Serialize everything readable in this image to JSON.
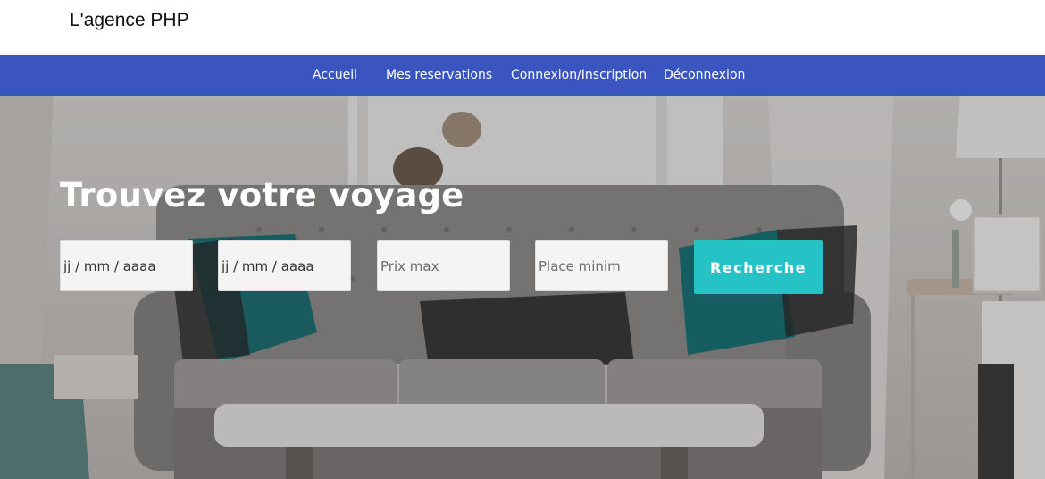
{
  "brand": {
    "title": "L'agence PHP"
  },
  "nav": {
    "items": [
      {
        "label": "Accueil"
      },
      {
        "label": "Mes reservations"
      },
      {
        "label": "Connexion/Inscription"
      },
      {
        "label": "Déconnexion"
      }
    ]
  },
  "hero": {
    "title": "Trouvez votre voyage",
    "form": {
      "date_start_value": "jj / mm / aaaa",
      "date_end_value": "jj / mm / aaaa",
      "price_placeholder": "Prix max",
      "places_placeholder": "Place minim",
      "submit_label": "Recherche"
    }
  },
  "colors": {
    "nav_bg": "#3a55c0",
    "button_bg": "#25c3c6",
    "hero_text": "#ffffff"
  }
}
